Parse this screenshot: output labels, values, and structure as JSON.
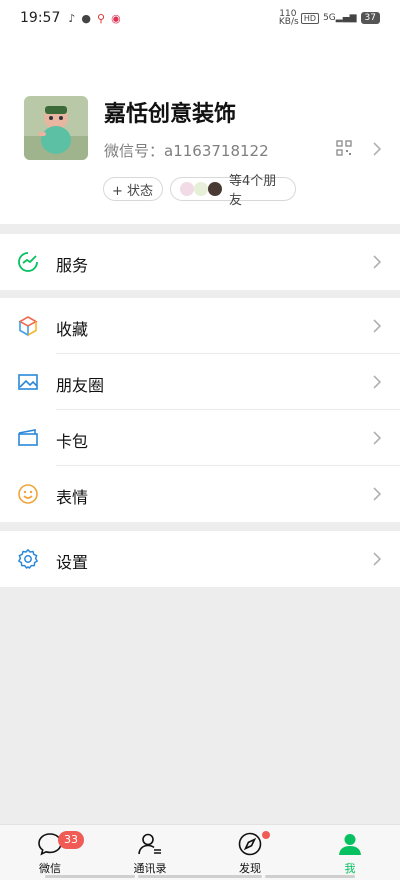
{
  "status_bar": {
    "time": "19:57",
    "net_speed": "110 KB/s",
    "hd_label": "HD",
    "signal_label": "5G",
    "battery": "37"
  },
  "profile": {
    "name": "嘉恬创意装饰",
    "wechat_id": "微信号：a1163718122",
    "status_button": "+ 状态",
    "friends_label": "等4个朋友"
  },
  "menu": {
    "services": "服务",
    "favorites": "收藏",
    "moments": "朋友圈",
    "cards": "卡包",
    "stickers": "表情",
    "settings": "设置"
  },
  "tabbar": {
    "tabs": [
      {
        "label": "微信",
        "badge": "33"
      },
      {
        "label": "通讯录"
      },
      {
        "label": "发现"
      },
      {
        "label": "我"
      }
    ],
    "accent": "#07c160"
  }
}
